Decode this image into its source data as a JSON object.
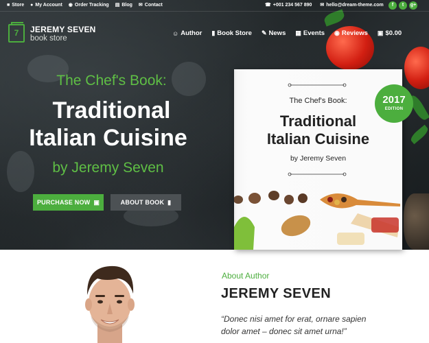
{
  "topbar": {
    "links": [
      {
        "icon": "book-icon",
        "label": "Store"
      },
      {
        "icon": "lock-icon",
        "label": "My Account"
      },
      {
        "icon": "globe-icon",
        "label": "Order Tracking"
      },
      {
        "icon": "document-icon",
        "label": "Blog"
      },
      {
        "icon": "envelope-icon",
        "label": "Contact"
      }
    ],
    "phone": "+001 234 567 890",
    "email": "hello@dream-theme.com",
    "social": [
      "f",
      "t",
      "g+"
    ]
  },
  "brand": {
    "logo_char": "7",
    "name": "JEREMY SEVEN",
    "subtitle": "book store"
  },
  "nav": [
    {
      "icon": "user-icon",
      "label": "Author"
    },
    {
      "icon": "book-icon",
      "label": "Book Store"
    },
    {
      "icon": "pencil-icon",
      "label": "News"
    },
    {
      "icon": "calendar-icon",
      "label": "Events"
    },
    {
      "icon": "chat-icon",
      "label": "Reviews"
    },
    {
      "icon": "cart-icon",
      "label": "$0.00"
    }
  ],
  "hero": {
    "kicker": "The Chef's Book:",
    "title_line1": "Traditional",
    "title_line2": "Italian Cuisine",
    "byline": "by Jeremy Seven",
    "buy_button": "PURCHASE NOW",
    "about_button": "ABOUT BOOK"
  },
  "book": {
    "kicker": "The Chef's Book:",
    "title_line1": "Traditional",
    "title_line2": "Italian Cuisine",
    "byline": "by Jeremy Seven",
    "badge_year": "2017",
    "badge_label": "EDITION"
  },
  "about": {
    "label": "About Author",
    "name": "JEREMY SEVEN",
    "quote_line1": "“Donec nisi amet for erat, ornare sapien",
    "quote_line2": "dolor amet  – donec sit amet urna!”"
  },
  "colors": {
    "accent": "#4cae3e",
    "dark": "#1f2426"
  }
}
